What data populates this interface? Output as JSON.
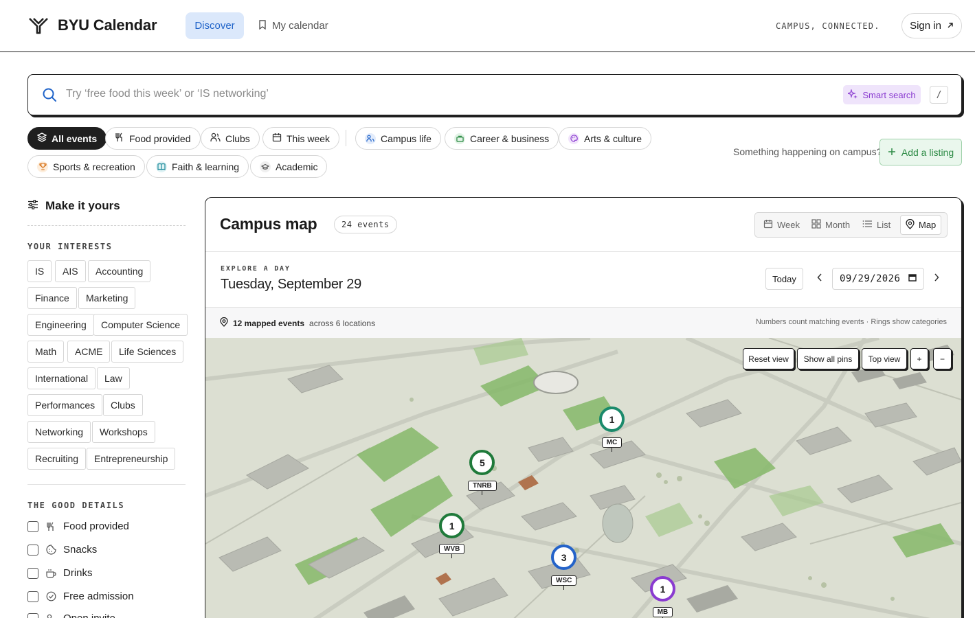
{
  "header": {
    "brand": "BYU Calendar",
    "nav": {
      "discover": "Discover",
      "my_calendar": "My calendar"
    },
    "tagline": "CAMPUS, CONNECTED.",
    "sign_in": "Sign in"
  },
  "search": {
    "placeholder": "Try ‘free food this week’ or ‘IS networking’",
    "smart_search": "Smart search",
    "shortcut": "/"
  },
  "filters": {
    "all_events": "All events",
    "food_provided": "Food provided",
    "clubs": "Clubs",
    "this_week": "This week",
    "campus_life": "Campus life",
    "career_business": "Career & business",
    "arts_culture": "Arts & culture",
    "sports_recreation": "Sports & recreation",
    "faith_learning": "Faith & learning",
    "academic": "Academic"
  },
  "cta": {
    "prompt": "Something happening on campus?",
    "add_listing": "Add a listing"
  },
  "sidebar": {
    "title": "Make it yours",
    "interests_heading": "YOUR INTERESTS",
    "interests": [
      "IS",
      "AIS",
      "Accounting",
      "Finance",
      "Marketing",
      "Engineering",
      "Computer Science",
      "Math",
      "ACME",
      "Life Sciences",
      "International",
      "Law",
      "Performances",
      "Clubs",
      "Networking",
      "Workshops",
      "Recruiting",
      "Entrepreneurship"
    ],
    "details_heading": "THE GOOD DETAILS",
    "details": [
      "Food provided",
      "Snacks",
      "Drinks",
      "Free admission",
      "Open invite"
    ]
  },
  "panel": {
    "title": "Campus map",
    "count": "24 events",
    "views": {
      "week": "Week",
      "month": "Month",
      "list": "List",
      "map": "Map"
    },
    "explore_label": "EXPLORE A DAY",
    "date_heading": "Tuesday, September 29",
    "today": "Today",
    "date_value": "09/29/2026",
    "mapped_count": "12 mapped events",
    "mapped_suffix": "across 6 locations",
    "legend_note": "Numbers count matching events · Rings show categories"
  },
  "map": {
    "controls": {
      "reset": "Reset view",
      "show_all": "Show all pins",
      "top_view": "Top view",
      "zoom_in": "+",
      "zoom_out": "−"
    },
    "pins": [
      {
        "label": "MC",
        "count": "1",
        "ring": "#1b8a6b"
      },
      {
        "label": "TNRB",
        "count": "5",
        "ring": "#1f7a3a"
      },
      {
        "label": "WVB",
        "count": "1",
        "ring": "#1f7a3a"
      },
      {
        "label": "WSC",
        "count": "3",
        "ring": "#2463c9"
      },
      {
        "label": "MB",
        "count": "1",
        "ring": "#8a3bd0"
      }
    ]
  },
  "colors": {
    "accent_blue": "#1f63c9",
    "accent_green": "#2e8b46",
    "accent_purple": "#8a3bd0",
    "ink": "#1f1f1f"
  }
}
